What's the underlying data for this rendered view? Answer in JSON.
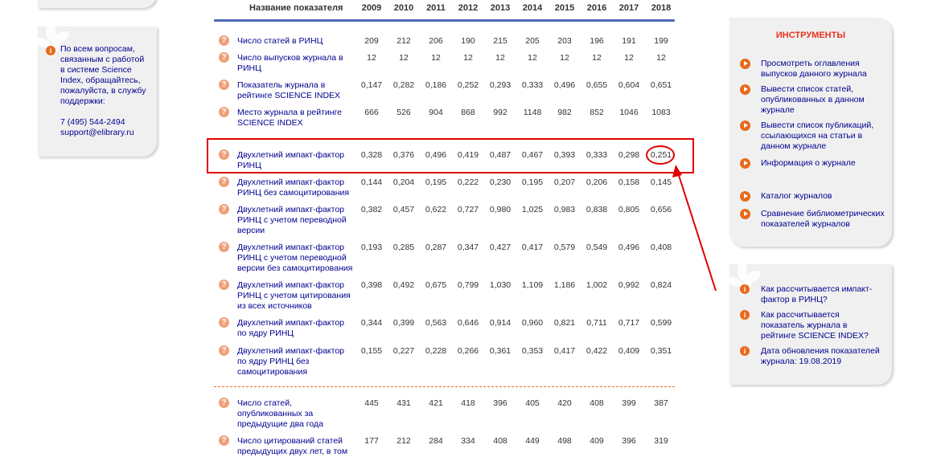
{
  "help": {
    "lines": [
      "По всем вопросам,",
      "связанным с работой",
      "в системе Science",
      "Index, обращайтесь,",
      "пожалуйста, в службу",
      "поддержки:"
    ],
    "phone": "7 (495) 544-2494",
    "email": "support@elibrary.ru"
  },
  "table": {
    "header_name": "Название показателя",
    "years": [
      "2009",
      "2010",
      "2011",
      "2012",
      "2013",
      "2014",
      "2015",
      "2016",
      "2017",
      "2018"
    ],
    "rows": [
      {
        "name": [
          "Число статей в РИНЦ"
        ],
        "values": [
          "209",
          "212",
          "206",
          "190",
          "215",
          "205",
          "203",
          "196",
          "191",
          "199"
        ]
      },
      {
        "name": [
          "Число выпусков журнала в",
          "РИНЦ"
        ],
        "values": [
          "12",
          "12",
          "12",
          "12",
          "12",
          "12",
          "12",
          "12",
          "12",
          "12"
        ]
      },
      {
        "name": [
          "Показатель журнала в",
          "рейтинге SCIENCE INDEX"
        ],
        "values": [
          "0,147",
          "0,282",
          "0,186",
          "0,252",
          "0,293",
          "0,333",
          "0,496",
          "0,655",
          "0,604",
          "0,651"
        ]
      },
      {
        "name": [
          "Место журнала в рейтинге",
          "SCIENCE INDEX"
        ],
        "values": [
          "666",
          "526",
          "904",
          "868",
          "992",
          "1148",
          "982",
          "852",
          "1046",
          "1083"
        ]
      },
      {
        "name": [
          "Двухлетний импакт-фактор",
          "РИНЦ"
        ],
        "values": [
          "0,328",
          "0,376",
          "0,496",
          "0,419",
          "0,487",
          "0,467",
          "0,393",
          "0,333",
          "0,298",
          "0,251"
        ]
      },
      {
        "name": [
          "Двухлетний импакт-фактор",
          "РИНЦ без самоцитирования"
        ],
        "values": [
          "0,144",
          "0,204",
          "0,195",
          "0,222",
          "0,230",
          "0,195",
          "0,207",
          "0,206",
          "0,158",
          "0,145"
        ]
      },
      {
        "name": [
          "Двухлетний импакт-фактор",
          "РИНЦ с учетом переводной",
          "версии"
        ],
        "values": [
          "0,382",
          "0,457",
          "0,622",
          "0,727",
          "0,980",
          "1,025",
          "0,983",
          "0,838",
          "0,805",
          "0,656"
        ]
      },
      {
        "name": [
          "Двухлетний импакт-фактор",
          "РИНЦ с учетом переводной",
          "версии без самоцитирования"
        ],
        "values": [
          "0,193",
          "0,285",
          "0,287",
          "0,347",
          "0,427",
          "0,417",
          "0,579",
          "0,549",
          "0,496",
          "0,408"
        ]
      },
      {
        "name": [
          "Двухлетний импакт-фактор",
          "РИНЦ с учетом цитирования",
          "из всех источников"
        ],
        "values": [
          "0,398",
          "0,492",
          "0,675",
          "0,799",
          "1,030",
          "1,109",
          "1,186",
          "1,002",
          "0,992",
          "0,824"
        ]
      },
      {
        "name": [
          "Двухлетний импакт-фактор",
          "по ядру РИНЦ"
        ],
        "values": [
          "0,344",
          "0,399",
          "0,563",
          "0,646",
          "0,914",
          "0,960",
          "0,821",
          "0,711",
          "0,717",
          "0,599"
        ]
      },
      {
        "name": [
          "Двухлетний импакт-фактор",
          "по ядру РИНЦ без",
          "самоцитирования"
        ],
        "values": [
          "0,155",
          "0,227",
          "0,228",
          "0,266",
          "0,361",
          "0,353",
          "0,417",
          "0,422",
          "0,409",
          "0,351"
        ]
      },
      {
        "name": [
          "Число статей,",
          "опубликованных за",
          "предыдущие два года"
        ],
        "values": [
          "445",
          "431",
          "421",
          "418",
          "396",
          "405",
          "420",
          "408",
          "399",
          "387"
        ]
      },
      {
        "name": [
          "Число цитирований статей",
          "предыдущих двух лет, в том"
        ],
        "values": [
          "177",
          "212",
          "284",
          "334",
          "408",
          "449",
          "498",
          "409",
          "396",
          "319"
        ]
      }
    ]
  },
  "tools": {
    "title": "ИНСТРУМЕНТЫ",
    "items": [
      [
        "Просмотреть оглавления",
        "выпусков данного журнала"
      ],
      [
        "Вывести список статей,",
        "опубликованных в данном",
        "журнале"
      ],
      [
        "Вывести список публикаций,",
        "ссылающихся на статьи в",
        "данном журнале"
      ],
      [
        "Информация о журнале"
      ],
      [
        "Каталог журналов"
      ],
      [
        "Сравнение библиометрических",
        "показателей журналов"
      ]
    ]
  },
  "info": {
    "items": [
      [
        "Как рассчитывается импакт-",
        "фактор в РИНЦ?"
      ],
      [
        "Как рассчитывается",
        "показатель журнала в",
        "рейтинге SCIENCE INDEX?"
      ],
      [
        "Дата обновления показателей",
        "журнала: 19.08.2019"
      ]
    ]
  },
  "colors": {
    "accent": "#e86a1c",
    "link": "#00008f",
    "highlight": "#e00000",
    "header_line": "#4d68b8"
  }
}
